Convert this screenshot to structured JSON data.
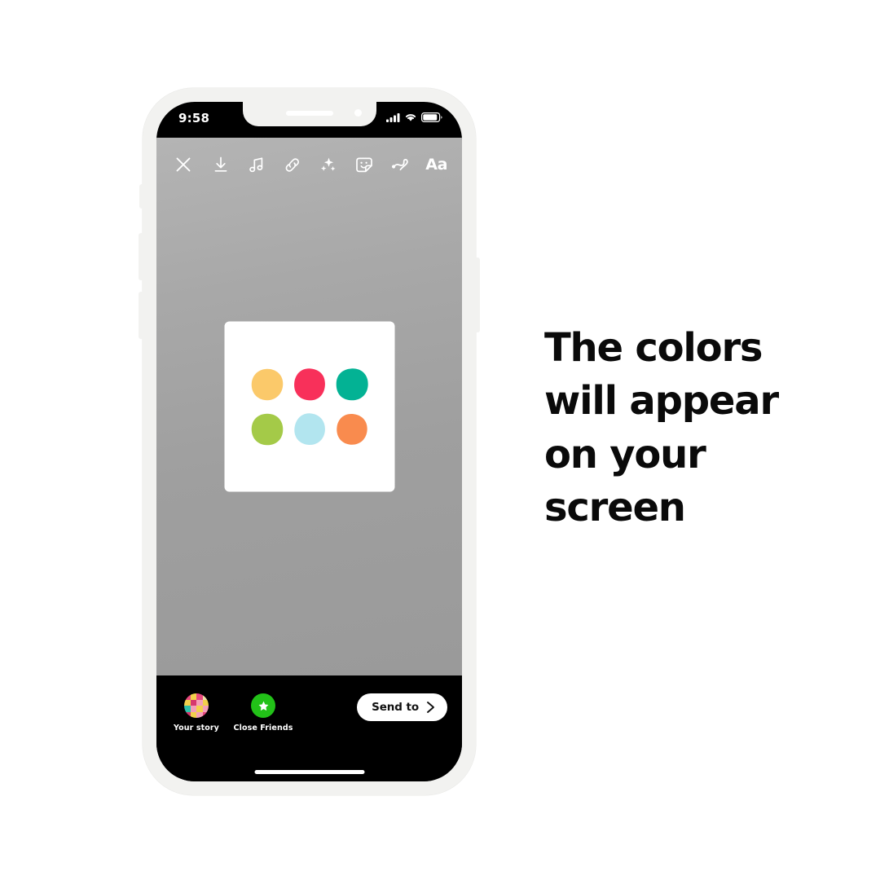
{
  "headline": "The colors will appear on your screen",
  "phone": {
    "status_bar": {
      "time": "9:58",
      "icons": [
        "cellular-signal-icon",
        "wifi-icon",
        "battery-icon"
      ]
    },
    "story_toolbar": {
      "close_label": "close-icon",
      "tools": [
        {
          "name": "download-icon",
          "label": "Save"
        },
        {
          "name": "music-icon",
          "label": "Music"
        },
        {
          "name": "link-icon",
          "label": "Link"
        },
        {
          "name": "sparkles-icon",
          "label": "Effects"
        },
        {
          "name": "sticker-icon",
          "label": "Stickers"
        },
        {
          "name": "draw-icon",
          "label": "Draw"
        },
        {
          "name": "text-icon",
          "label": "Aa"
        }
      ],
      "text_tool_label": "Aa"
    },
    "canvas": {
      "card": {
        "swatches": [
          {
            "name": "swatch-yellow",
            "color": "#fbc96a"
          },
          {
            "name": "swatch-crimson",
            "color": "#f8305a"
          },
          {
            "name": "swatch-teal",
            "color": "#03b294"
          },
          {
            "name": "swatch-green",
            "color": "#a4ca48"
          },
          {
            "name": "swatch-lightblue",
            "color": "#b2e5ef"
          },
          {
            "name": "swatch-orange",
            "color": "#f98b4e"
          }
        ]
      }
    },
    "bottom_bar": {
      "audience": [
        {
          "name": "your-story",
          "label": "Your story"
        },
        {
          "name": "close-friends",
          "label": "Close Friends"
        }
      ],
      "send_button_label": "Send to",
      "close_friends_color": "#22c118",
      "avatar_colors": [
        "#e8497f",
        "#f2d04b",
        "#e8497f",
        "#efe0a8",
        "#f2d04b",
        "#d6376e",
        "#f5a0b8",
        "#f2d04b",
        "#2fc0a8",
        "#f5a0b8",
        "#f2d04b",
        "#f5a0b8",
        "#d6376e",
        "#f2d04b",
        "#f5a0b8",
        "#e8497f"
      ]
    }
  }
}
